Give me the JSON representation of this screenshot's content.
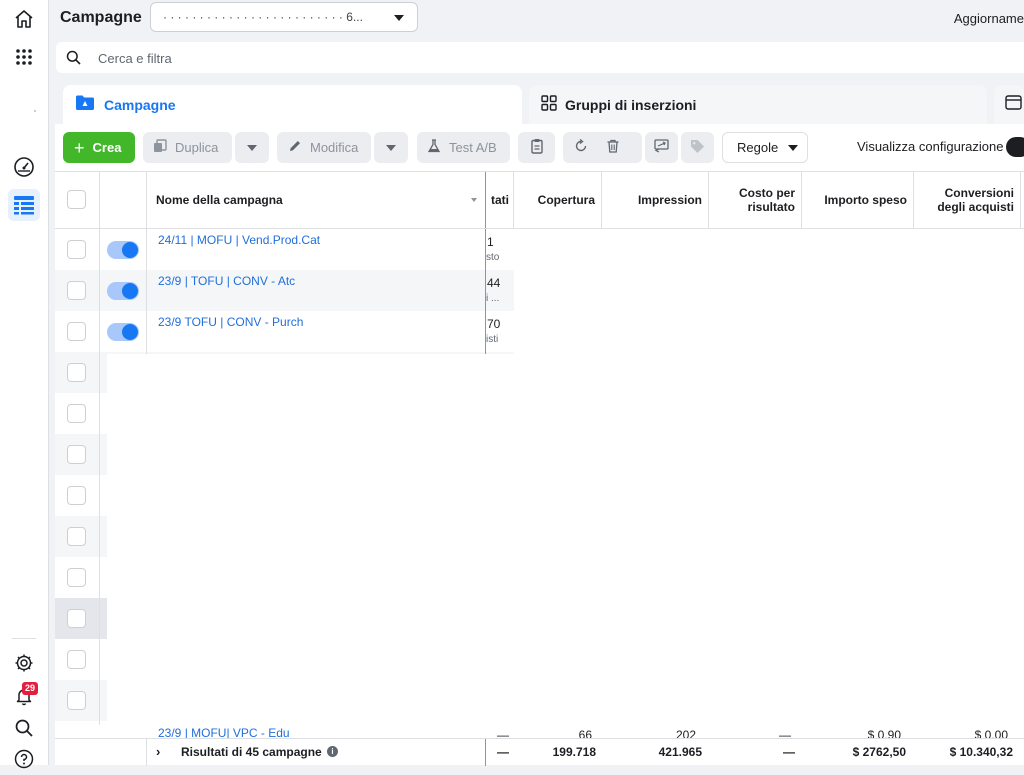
{
  "nav": {
    "notification_count": "29"
  },
  "topbar": {
    "title": "Campagne",
    "account_value": "· · · · · · · · · · · · · · · · · · · · · · · · · 6...",
    "update_label": "Aggiorname"
  },
  "search": {
    "placeholder": "Cerca e filtra"
  },
  "tabs": [
    {
      "label": "Campagne"
    },
    {
      "label": "Gruppi di inserzioni"
    }
  ],
  "toolbar": {
    "create": "Crea",
    "duplicate": "Duplica",
    "edit": "Modifica",
    "ab_test": "Test A/B",
    "rules": "Regole",
    "view_settings": "Visualizza configurazione"
  },
  "table": {
    "headers": {
      "name": "Nome della campagna",
      "results": "tati",
      "reach": "Copertura",
      "impressions": "Impression",
      "cost_per_result": "Costo per risultato",
      "amount_spent": "Importo speso",
      "purchase_conversions": "Conversioni degli acquisti"
    },
    "rows": [
      {
        "name": "24/11 | MOFU | Vend.Prod.Cat",
        "result": "1",
        "result_sub": "sto"
      },
      {
        "name": "23/9 | TOFU | CONV - Atc",
        "result": "44",
        "result_sub": "i ..."
      },
      {
        "name": "23/9 TOFU | CONV - Purch",
        "result": "70",
        "result_sub": "isti"
      }
    ],
    "last_row": {
      "name": "23/9 | MOFU| VPC - Edu",
      "results": "—",
      "reach": "66",
      "impressions": "202",
      "cost_per_result": "—",
      "amount_spent": "$ 0,90",
      "purchase_conversions": "$ 0,00"
    },
    "footer": {
      "label": "Risultati di 45 campagne",
      "results": "—",
      "reach": "199.718",
      "impressions": "421.965",
      "cost_per_result": "—",
      "amount_spent": "$ 2762,50",
      "purchase_conversions": "$ 10.340,32"
    }
  },
  "colors": {
    "accent": "#1877f2",
    "create_button": "#42b72a",
    "link": "#216fdb",
    "badge": "#e41e3f"
  }
}
